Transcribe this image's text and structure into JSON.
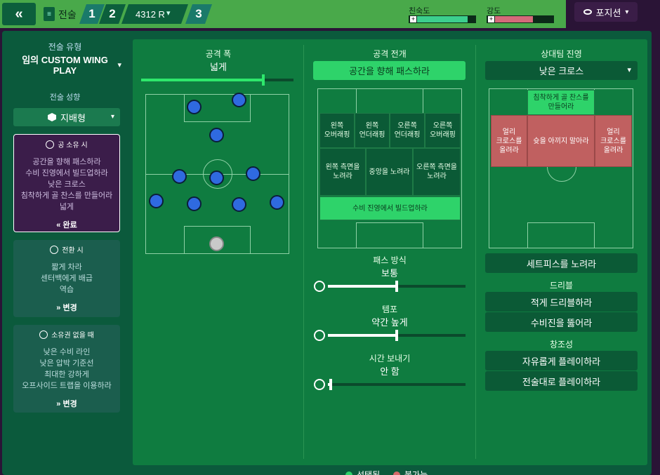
{
  "topbar": {
    "back_icon": "«",
    "tactics_label": "전술",
    "slot1": "1",
    "slot2": "2",
    "formation": "4312 R",
    "slot3": "3",
    "familiarity_label": "친숙도",
    "intensity_label": "강도",
    "familiarity_level": 0.86,
    "intensity_level": 0.64,
    "familiarity_color": "#3ccf8e",
    "intensity_color": "#d46a7a",
    "position_button": "포지션"
  },
  "sidebar": {
    "tactic_type_label": "전술 유형",
    "tactic_name": "임의 CUSTOM WING PLAY",
    "mentality_label": "전술 성향",
    "mentality_value": "지배형",
    "in_possession": {
      "title": "공 소유 시",
      "items": [
        "공간을 향해 패스하라",
        "수비 진영에서 빌드업하라",
        "낮은 크로스",
        "침착하게 골 찬스를 만들어라",
        "넓게"
      ],
      "action": "완료"
    },
    "transition": {
      "title": "전환 시",
      "items": [
        "짧게 차라",
        "센터백에게 배급",
        "역습"
      ],
      "action": "변경"
    },
    "out_of_possession": {
      "title": "소유권 없을 때",
      "items": [
        "낮은 수비 라인",
        "낮은 압박 기준선",
        "최대한 강하게",
        "오프사이드 트랩을 이용하라"
      ],
      "action": "변경"
    }
  },
  "attacking_width": {
    "title": "공격 폭",
    "value": "넓게",
    "level": 0.8
  },
  "approach": {
    "title": "공격 전개",
    "value": "공간을 향해 패스하라",
    "zones": {
      "left_overlap": "왼쪽\n오버래핑",
      "left_underlap": "왼쪽\n언더래핑",
      "right_underlap": "오른쪽\n언더래핑",
      "right_overlap": "오른쪽\n오버래핑",
      "left_flank": "왼쪽 측면을\n노려라",
      "center": "중앙을 노려라",
      "right_flank": "오른쪽 측면을\n노려라",
      "buildup": "수비 진영에서 빌드업하라"
    },
    "passing_title": "패스 방식",
    "passing_value": "보통",
    "passing_level": 0.5,
    "tempo_title": "템포",
    "tempo_value": "약간 높게",
    "tempo_level": 0.5,
    "timewaste_title": "시간 보내기",
    "timewaste_value": "안 함",
    "timewaste_level": 0.02
  },
  "final_third": {
    "title": "상대팀 진영",
    "value": "낮은 크로스",
    "zones": {
      "patient": "침착하게 골 찬스를\n만들어라",
      "left_cross": "얼리\n크로스를\n올려라",
      "center_shoot": "슛을 아끼지 말아라",
      "right_cross": "얼리\n크로스를\n올려라"
    },
    "set_piece": "세트피스를 노려라",
    "dribble_title": "드리블",
    "dribble_less": "적게 드리블하라",
    "dribble_defence": "수비진을 뚫어라",
    "creative_title": "창조성",
    "creative_free": "자유롭게 플레이하라",
    "creative_disciplined": "전술대로 플레이하라"
  },
  "legend": {
    "selected": "선택됨",
    "unavailable": "불가능"
  }
}
